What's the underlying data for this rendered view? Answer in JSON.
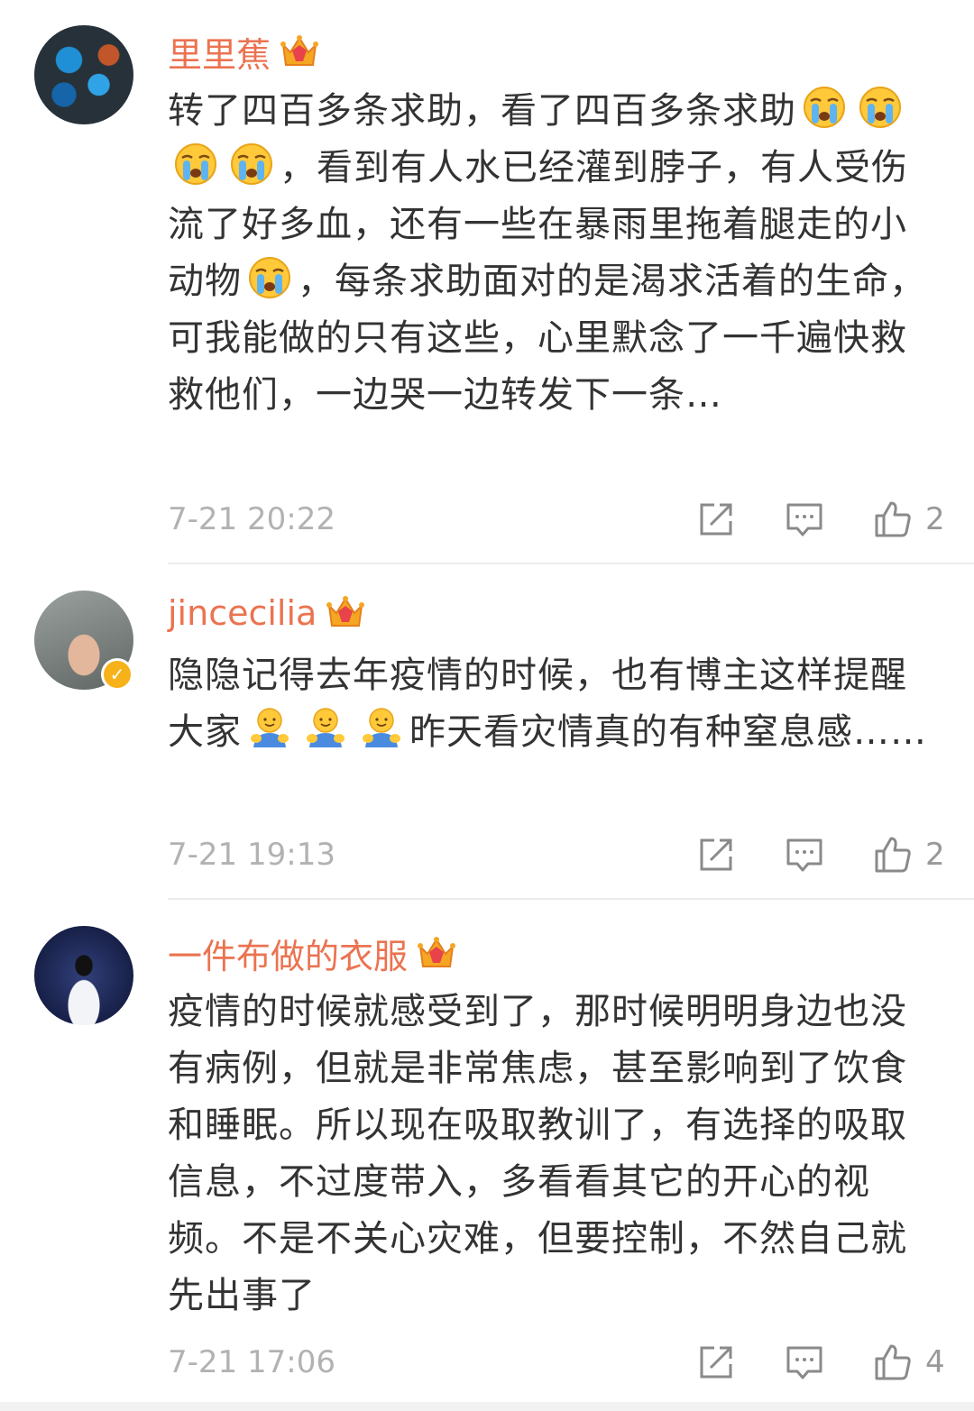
{
  "comments": [
    {
      "username": "里里蕉",
      "crown_level": "1",
      "text_parts": [
        "转了四百多条求助，看了四百多条求助",
        "，看到有人水已经灌到脖子，有人受伤流了好多血，还有一些在暴雨里拖着腿走的小动物",
        "，每条求助面对的是渴求活着的生命，可我能做的只有这些，心里默念了一千遍快救救他们，一边哭一边转发下一条…"
      ],
      "time": "7-21 20:22",
      "likes": "2"
    },
    {
      "username": "jincecilia",
      "crown_level": "7",
      "verified": true,
      "text_parts": [
        "隐隐记得去年疫情的时候，也有博主这样提醒大家",
        "昨天看灾情真的有种窒息感……"
      ],
      "time": "7-21 19:13",
      "likes": "2"
    },
    {
      "username": "一件布做的衣服",
      "crown_level": "2",
      "text_parts": [
        "疫情的时候就感受到了，那时候明明身边也没有病例，但就是非常焦虑，甚至影响到了饮食和睡眠。所以现在吸取教训了，有选择的吸取信息，不过度带入，多看看其它的开心的视频。不是不关心灾难，但要控制，不然自己就先出事了"
      ],
      "time": "7-21 17:06",
      "likes": "4"
    }
  ],
  "icons": {
    "crown": "crown-icon",
    "cry_emoji": "crying-face-emoji",
    "hug_emoji": "hug-emoji",
    "repost": "repost-icon",
    "reply": "comment-icon",
    "like": "thumbs-up-icon",
    "verified": "verified-badge-icon"
  },
  "colors": {
    "username": "#eb7350",
    "text": "#333333",
    "meta": "#b2b2b2",
    "crown": "#f0a03c",
    "verified": "#f7b21a"
  }
}
